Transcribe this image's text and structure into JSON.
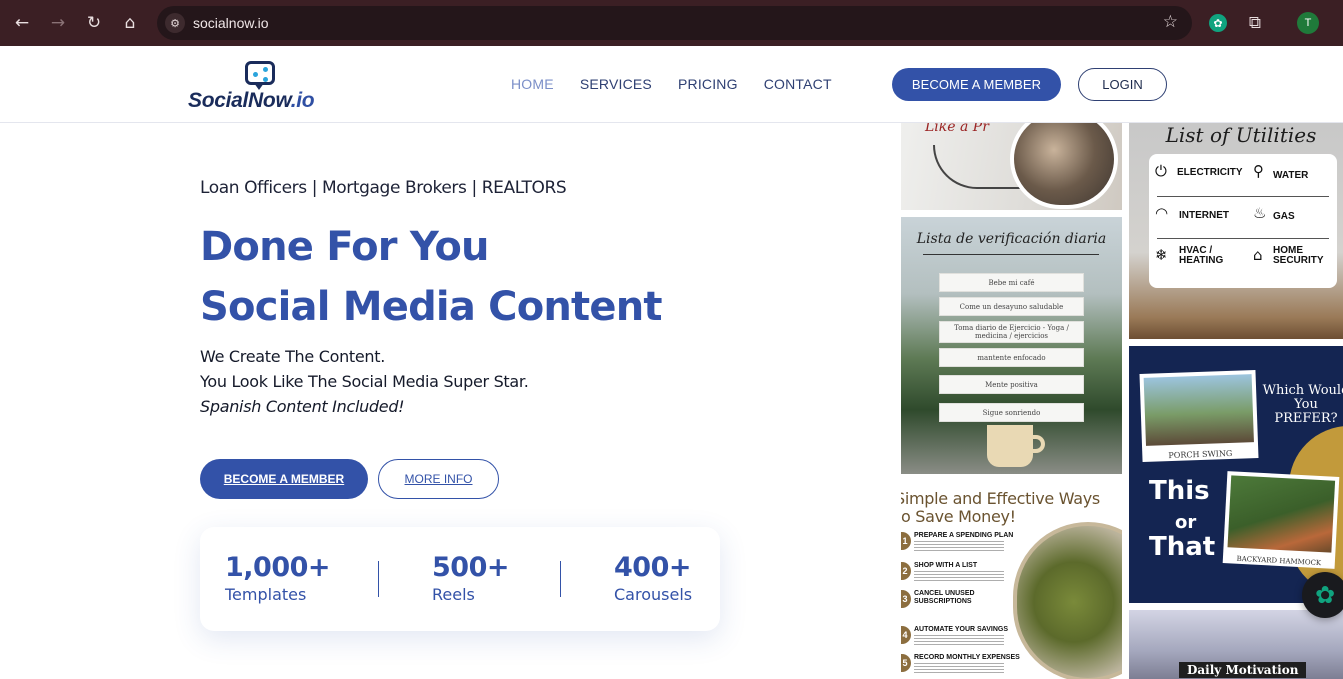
{
  "browser": {
    "back_icon": "←",
    "forward_icon": "→",
    "reload_icon": "↻",
    "home_icon": "⌂",
    "site_info_icon": "⚙",
    "url": "socialnow.io",
    "bookmark_icon": "☆",
    "extension_gpt_icon": "✿",
    "extensions_icon": "⧉",
    "profile_initial": "T",
    "colors": {
      "frame": "#3b1f24",
      "omnibox": "#24161a",
      "profile": "#1f7a3a"
    }
  },
  "header": {
    "logo": {
      "brand": "SocialNow",
      "tld": ".io"
    },
    "nav": [
      {
        "label": "HOME",
        "active": true
      },
      {
        "label": "SERVICES",
        "active": false
      },
      {
        "label": "PRICING",
        "active": false
      },
      {
        "label": "CONTACT",
        "active": false
      }
    ],
    "become_member_label": "BECOME A MEMBER",
    "login_label": "LOGIN"
  },
  "hero": {
    "audience": "Loan Officers | Mortgage Brokers |  REALTORS",
    "headline_line1": "Done For You",
    "headline_line2": "Social Media Content",
    "sub_line1": "We Create The Content.",
    "sub_line2": "You Look Like The Social Media Super Star.",
    "sub_line3": "Spanish Content Included!",
    "primary_cta": "BECOME A MEMBER",
    "secondary_cta": "MORE INFO",
    "accent_color": "#3352a8",
    "stats": [
      {
        "value": "1,000+",
        "label": "Templates"
      },
      {
        "value": "500+",
        "label": "Reels"
      },
      {
        "value": "400+",
        "label": "Carousels"
      }
    ]
  },
  "gallery": {
    "tile1": {
      "caption": "Like a Pr"
    },
    "tile2": {
      "title": "List of Utilities",
      "rows": [
        [
          {
            "icon": "⏻",
            "label": "ELECTRICITY"
          },
          {
            "icon": "⚲",
            "label": "WATER"
          }
        ],
        [
          {
            "icon": "◠",
            "label": "INTERNET"
          },
          {
            "icon": "♨",
            "label": "GAS"
          }
        ],
        [
          {
            "icon": "❄",
            "label": "HVAC / HEATING"
          },
          {
            "icon": "⌂",
            "label": "HOME SECURITY"
          }
        ]
      ]
    },
    "tile3": {
      "title": "Lista de verificación diaria",
      "items": [
        "Bebe mi café",
        "Come un desayuno saludable",
        "Toma diario de Ejercicio - Yoga / medicina / ejercicios",
        "mantente enfocado",
        "Mente positiva",
        "Sigue sonriendo"
      ]
    },
    "tile4": {
      "question": "Which Would You PREFER?",
      "option1_caption": "PORCH SWING",
      "this_text": "This",
      "or_text": "or",
      "that_text": "That",
      "option2_caption": "BACKYARD HAMMOCK"
    },
    "tile5": {
      "title": "Simple and Effective Ways to Save Money!",
      "steps": [
        {
          "num": "1",
          "heading": "PREPARE A SPENDING PLAN"
        },
        {
          "num": "2",
          "heading": "SHOP WITH A LIST"
        },
        {
          "num": "3",
          "heading": "CANCEL UNUSED SUBSCRIPTIONS"
        },
        {
          "num": "4",
          "heading": "AUTOMATE YOUR SAVINGS"
        },
        {
          "num": "5",
          "heading": "RECORD MONTHLY EXPENSES"
        }
      ]
    },
    "tile6": {
      "label": "Daily Motivation"
    }
  },
  "chat_widget_icon": "✿"
}
